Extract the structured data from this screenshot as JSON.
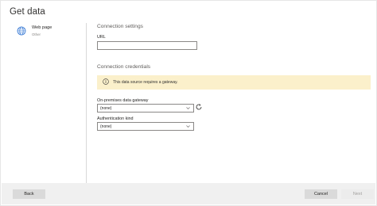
{
  "dialog": {
    "title": "Get data"
  },
  "sources": [
    {
      "name": "Web page",
      "category": "Other",
      "icon": "globe-icon"
    }
  ],
  "connection_settings": {
    "heading": "Connection settings",
    "url_label": "URL",
    "url_value": ""
  },
  "connection_credentials": {
    "heading": "Connection credentials",
    "banner_text": "This data source requires a gateway.",
    "banner_icon": "info-icon",
    "gateway_label": "On-premises data gateway",
    "gateway_value": "(none)",
    "auth_label": "Authentication kind",
    "auth_value": "(none)"
  },
  "footer": {
    "back_label": "Back",
    "cancel_label": "Cancel",
    "next_label": "Next"
  },
  "colors": {
    "banner_bg": "#fbf0cb",
    "globe": "#3a7bd5"
  }
}
